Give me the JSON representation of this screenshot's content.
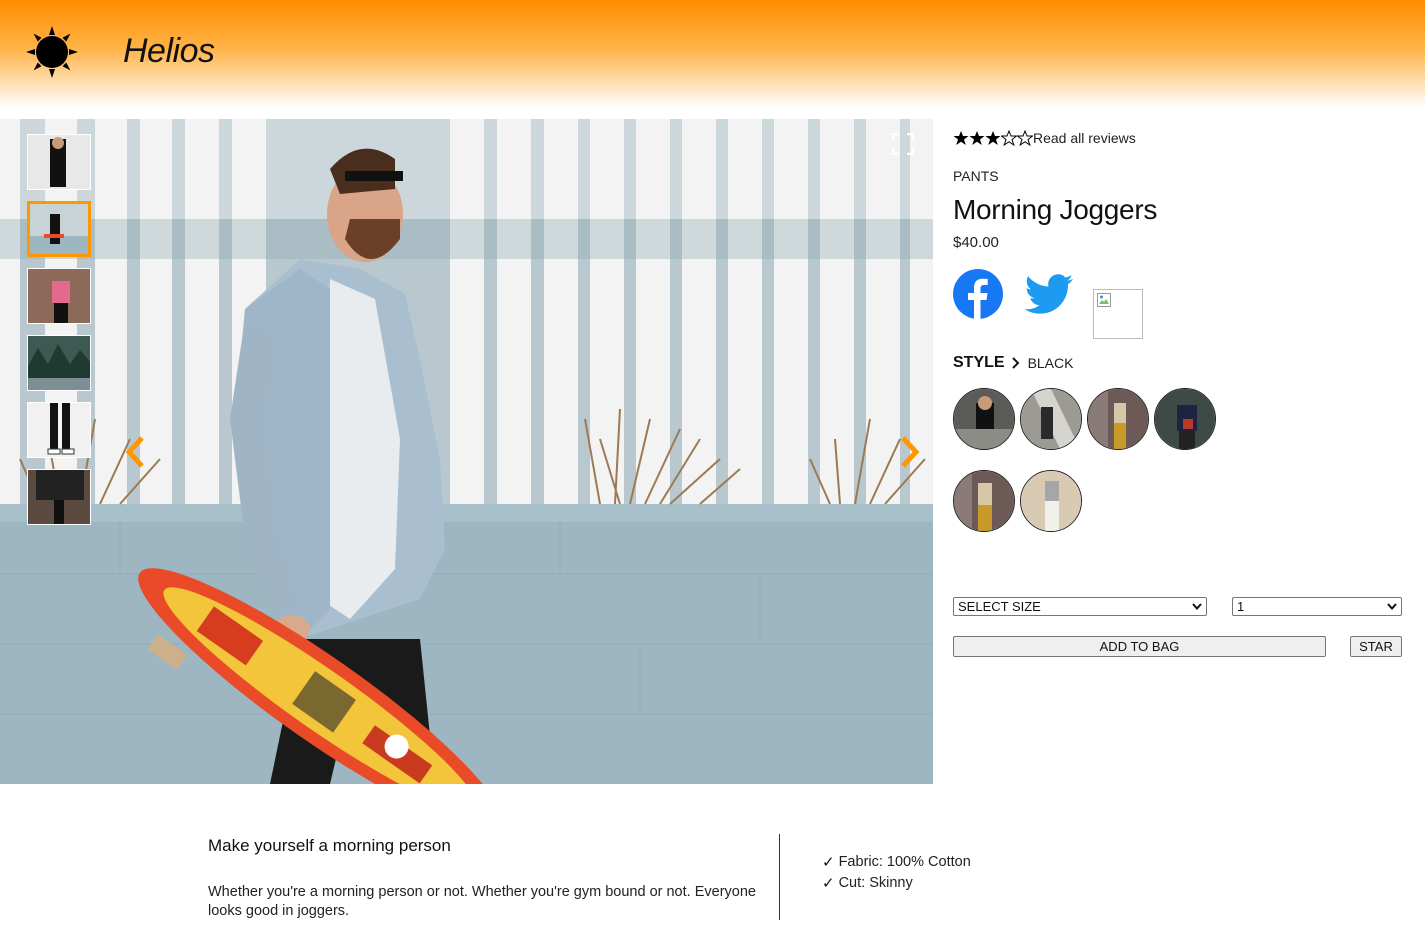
{
  "header": {
    "brand": "Helios",
    "logo_icon": "sun-icon",
    "gradient_top": "#ff8c00"
  },
  "gallery": {
    "thumbnail_count": 6,
    "active_thumbnail": 2,
    "expand_icon": "expand-icon",
    "prev_icon": "chevron-left-icon",
    "next_icon": "chevron-right-icon",
    "accent_color": "#ff9800"
  },
  "product": {
    "rating": 3,
    "rating_max": 5,
    "reviews_link": "Read all reviews",
    "category": "PANTS",
    "name": "Morning Joggers",
    "price": "$40.00"
  },
  "social": {
    "facebook_icon": "facebook-icon",
    "twitter_icon": "twitter-icon",
    "facebook_color": "#1877f2",
    "twitter_color": "#1d9bf0"
  },
  "style": {
    "label": "STYLE",
    "selected": "BLACK",
    "swatch_count": 6
  },
  "controls": {
    "size_select": "SELECT SIZE",
    "quantity_select": "1",
    "add_to_bag": "ADD TO BAG",
    "star": "STAR"
  },
  "description": {
    "title": "Make yourself a morning person",
    "body": "Whether you're a morning person or not. Whether you're gym bound or not. Everyone looks good in joggers.",
    "features": [
      "Fabric: 100% Cotton",
      "Cut: Skinny"
    ]
  }
}
